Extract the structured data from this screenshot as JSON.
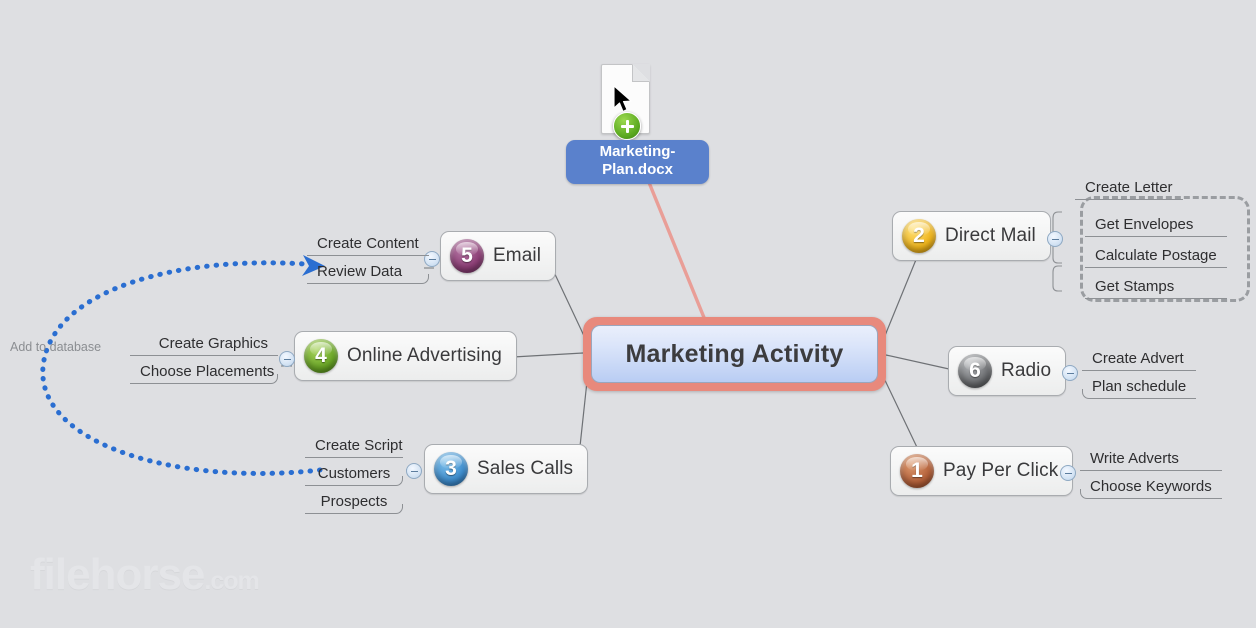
{
  "app": {
    "background_color": "#dedfe2",
    "watermark": "filehorse",
    "watermark_suffix": ".com"
  },
  "root": {
    "label": "Marketing Activity",
    "selected": true,
    "selection_color": "#e8897c",
    "fill_top": "#eaeffb",
    "fill_bottom": "#b9cdf3"
  },
  "drag": {
    "file_name": "Marketing-Plan.docx",
    "badge_icon": "plus-badge-icon",
    "cursor_icon": "mouse-cursor-icon",
    "document_icon": "document-icon",
    "label_color": "#5a81cc",
    "drop_line_color": "#e99a92"
  },
  "relationship": {
    "label": "Add to database",
    "color": "#2a6ed1",
    "from": "Customers",
    "to": "Review Data",
    "style": "dotted-arrow"
  },
  "branches": [
    {
      "name": "email",
      "label": "Email",
      "number": "5",
      "sphere_color": "#8e3f77",
      "toggle": "minus",
      "side": "left",
      "children": [
        "Create Content",
        "Review Data"
      ]
    },
    {
      "name": "online-advertising",
      "label": "Online Advertising",
      "number": "4",
      "sphere_color": "#6aa626",
      "toggle": "minus",
      "side": "left",
      "children": [
        "Create Graphics",
        "Choose Placements"
      ]
    },
    {
      "name": "sales-calls",
      "label": "Sales Calls",
      "number": "3",
      "sphere_color": "#3f8fd0",
      "toggle": "minus",
      "side": "left",
      "children": [
        "Create Script",
        "Customers",
        "Prospects"
      ]
    },
    {
      "name": "direct-mail",
      "label": "Direct Mail",
      "number": "2",
      "sphere_color": "#f0b51c",
      "toggle": "minus",
      "side": "right",
      "group_label": "Create Letter",
      "boundary": true,
      "children": [
        "Get Envelopes",
        "Calculate Postage",
        "Get Stamps"
      ]
    },
    {
      "name": "radio",
      "label": "Radio",
      "number": "6",
      "sphere_color": "#6d6f72",
      "toggle": "minus",
      "side": "right",
      "children": [
        "Create Advert",
        "Plan schedule"
      ]
    },
    {
      "name": "pay-per-click",
      "label": "Pay Per Click",
      "number": "1",
      "sphere_color": "#b5613a",
      "toggle": "minus",
      "side": "right",
      "children": [
        "Write Adverts",
        "Choose Keywords"
      ]
    }
  ]
}
